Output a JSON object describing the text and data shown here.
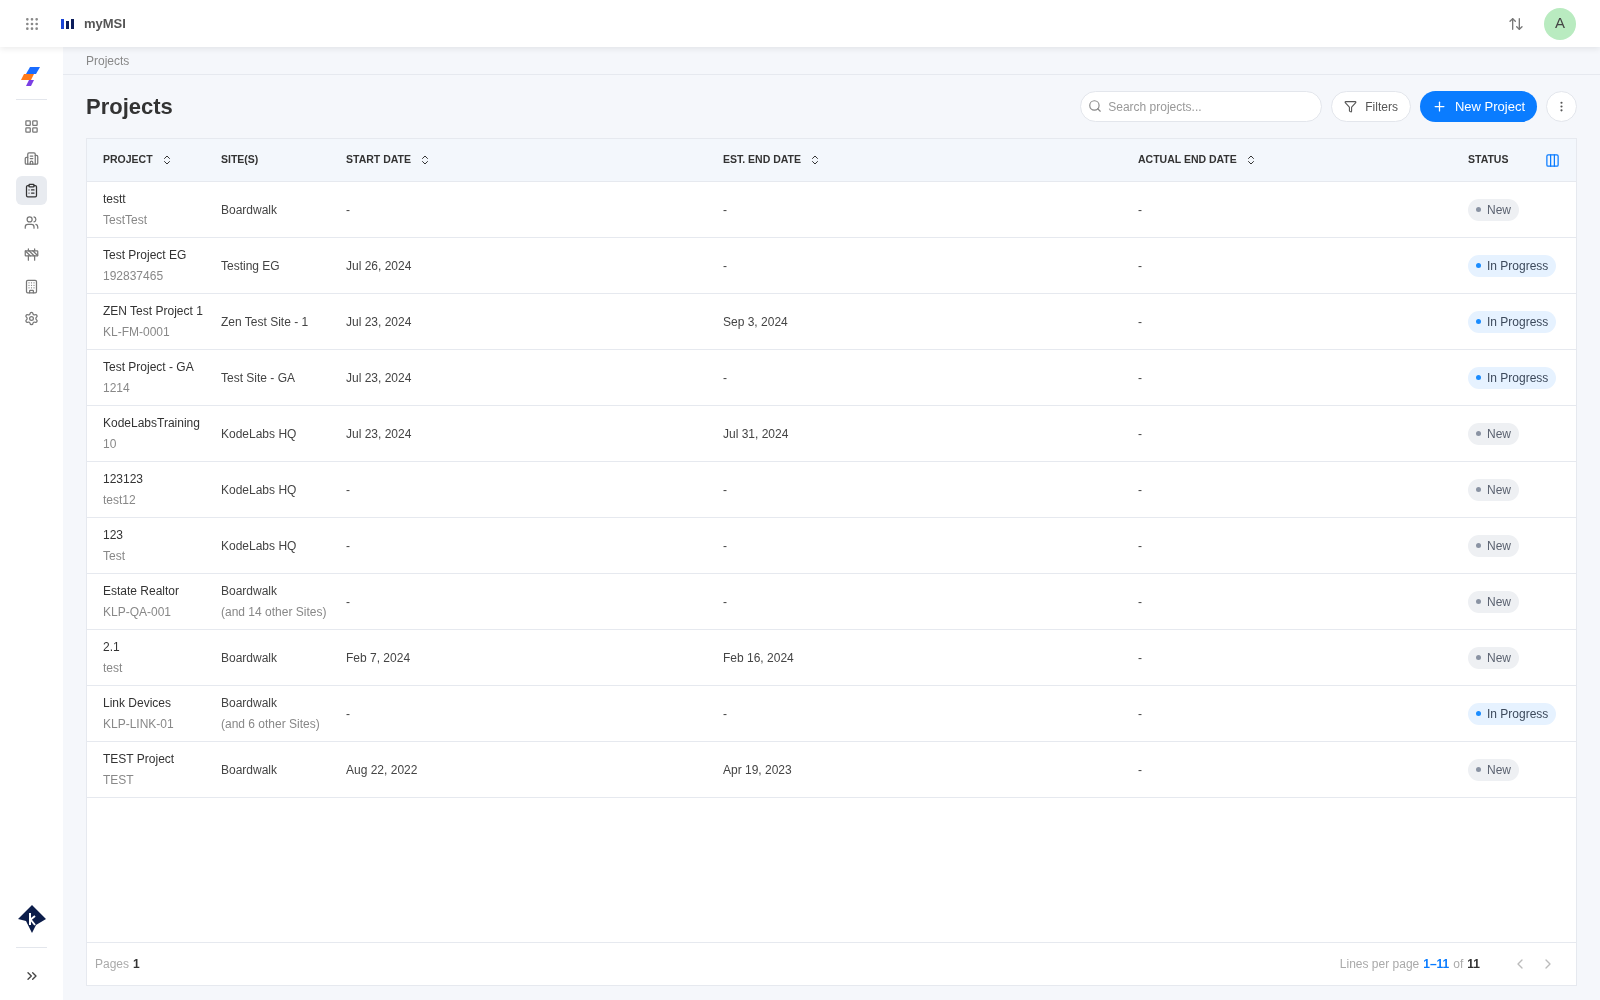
{
  "topbar": {
    "app_name": "myMSI",
    "avatar": "A"
  },
  "sidebar": {
    "items": [
      {
        "selected": false
      },
      {
        "selected": false
      },
      {
        "selected": true
      },
      {
        "selected": false
      },
      {
        "selected": false
      },
      {
        "selected": false
      },
      {
        "selected": false
      }
    ]
  },
  "breadcrumb": "Projects",
  "title": "Projects",
  "search": {
    "placeholder": "Search projects..."
  },
  "filters_button": "Filters",
  "new_button": "New Project",
  "table": {
    "columns": [
      {
        "label": "PROJECT",
        "sortable": true
      },
      {
        "label": "SITE(S)",
        "sortable": false
      },
      {
        "label": "START DATE",
        "sortable": true
      },
      {
        "label": "EST. END DATE",
        "sortable": true
      },
      {
        "label": "ACTUAL END DATE",
        "sortable": true
      },
      {
        "label": "STATUS",
        "sortable": false
      }
    ],
    "rows": [
      {
        "name": "testt",
        "code": "TestTest",
        "site": "Boardwalk",
        "start": "-",
        "est_end": "-",
        "actual_end": "-",
        "status": "New",
        "kind": "new"
      },
      {
        "name": "Test Project EG",
        "code": "192837465",
        "site": "Testing EG",
        "start": "Jul 26, 2024",
        "est_end": "-",
        "actual_end": "-",
        "status": "In Progress",
        "kind": "in_progress"
      },
      {
        "name": "ZEN Test Project 1",
        "code": "KL-FM-0001",
        "site": "Zen Test Site - 1",
        "start": "Jul 23, 2024",
        "est_end": "Sep 3, 2024",
        "actual_end": "-",
        "status": "In Progress",
        "kind": "in_progress"
      },
      {
        "name": "Test Project - GA",
        "code": "1214",
        "site": "Test Site - GA",
        "start": "Jul 23, 2024",
        "est_end": "-",
        "actual_end": "-",
        "status": "In Progress",
        "kind": "in_progress"
      },
      {
        "name": "KodeLabsTraining",
        "code": "10",
        "site": "KodeLabs HQ",
        "start": "Jul 23, 2024",
        "est_end": "Jul 31, 2024",
        "actual_end": "-",
        "status": "New",
        "kind": "new"
      },
      {
        "name": "123123",
        "code": "test12",
        "site": "KodeLabs HQ",
        "start": "-",
        "est_end": "-",
        "actual_end": "-",
        "status": "New",
        "kind": "new"
      },
      {
        "name": "123",
        "code": "Test",
        "site": "KodeLabs HQ",
        "start": "-",
        "est_end": "-",
        "actual_end": "-",
        "status": "New",
        "kind": "new"
      },
      {
        "name": "Estate Realtor",
        "code": "KLP-QA-001",
        "site": "Boardwalk",
        "site_extra": "(and 14 other Sites)",
        "start": "-",
        "est_end": "-",
        "actual_end": "-",
        "status": "New",
        "kind": "new"
      },
      {
        "name": "2.1",
        "code": "test",
        "site": "Boardwalk",
        "start": "Feb 7, 2024",
        "est_end": "Feb 16, 2024",
        "actual_end": "-",
        "status": "New",
        "kind": "new"
      },
      {
        "name": "Link Devices",
        "code": "KLP-LINK-01",
        "site": "Boardwalk",
        "site_extra": "(and 6 other Sites)",
        "start": "-",
        "est_end": "-",
        "actual_end": "-",
        "status": "In Progress",
        "kind": "in_progress"
      },
      {
        "name": "TEST Project",
        "code": "TEST",
        "site": "Boardwalk",
        "start": "Aug 22, 2022",
        "est_end": "Apr 19, 2023",
        "actual_end": "-",
        "status": "New",
        "kind": "new"
      }
    ]
  },
  "footer": {
    "pages_label": "Pages",
    "pages": "1",
    "lines_label": "Lines per page",
    "range": "1–11",
    "of": "of",
    "total": "11"
  }
}
